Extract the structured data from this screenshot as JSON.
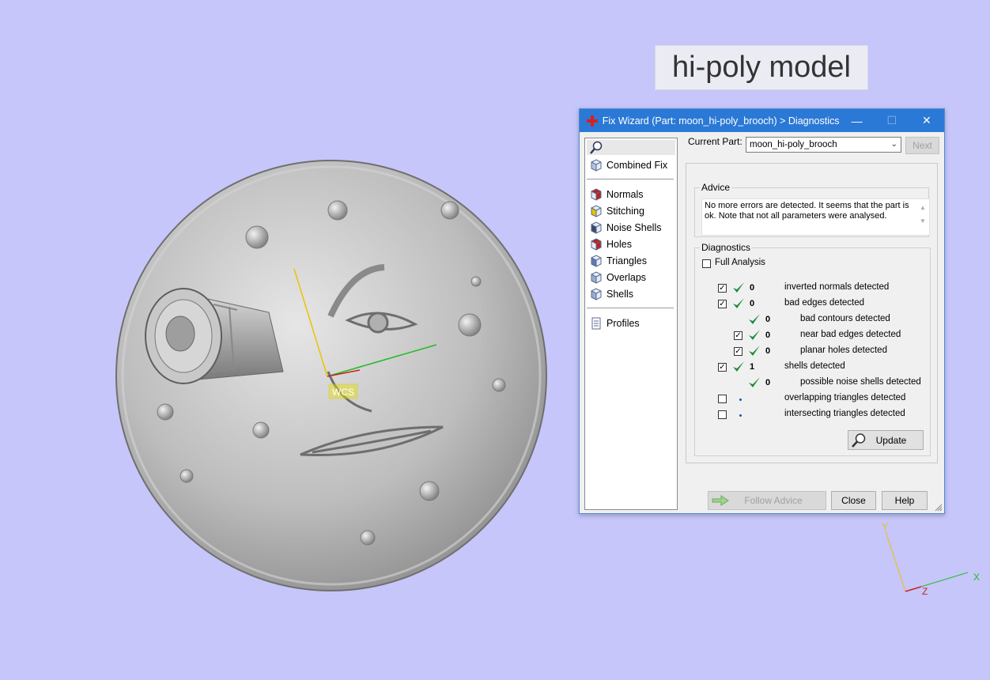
{
  "caption": "hi-poly model",
  "model": {
    "wcs_label": "WCS"
  },
  "axes_triad": {
    "x": "X",
    "y": "Y",
    "z": "Z"
  },
  "dialog": {
    "title": "Fix Wizard (Part: moon_hi-poly_brooch) > Diagnostics",
    "controls": {
      "minimize": "—",
      "maximize": "☐",
      "close": "✕"
    },
    "sidebar": {
      "top_items": [
        {
          "label": "Combined Fix",
          "icon": "combined-fix-icon"
        }
      ],
      "items": [
        {
          "label": "Normals",
          "icon": "normals-icon"
        },
        {
          "label": "Stitching",
          "icon": "stitching-icon"
        },
        {
          "label": "Noise Shells",
          "icon": "noise-shells-icon"
        },
        {
          "label": "Holes",
          "icon": "holes-icon"
        },
        {
          "label": "Triangles",
          "icon": "triangles-icon"
        },
        {
          "label": "Overlaps",
          "icon": "overlaps-icon"
        },
        {
          "label": "Shells",
          "icon": "shells-icon"
        }
      ],
      "bottom_items": [
        {
          "label": "Profiles",
          "icon": "profiles-icon"
        }
      ]
    },
    "current_part_label": "Current Part:",
    "current_part_value": "moon_hi-poly_brooch",
    "next_button": "Next",
    "advice": {
      "legend": "Advice",
      "text": "No more errors are detected. It seems that the part is ok. Note that not all parameters were analysed."
    },
    "diagnostics": {
      "legend": "Diagnostics",
      "full_analysis": {
        "label": "Full Analysis",
        "checked": false
      },
      "rows": [
        {
          "checkbox": true,
          "checked": true,
          "status": "ok",
          "count": "0",
          "label": "inverted normals detected",
          "indent": 0
        },
        {
          "checkbox": true,
          "checked": true,
          "status": "ok",
          "count": "0",
          "label": "bad edges detected",
          "indent": 0
        },
        {
          "checkbox": false,
          "checked": false,
          "status": "ok",
          "count": "0",
          "label": "bad contours detected",
          "indent": 1
        },
        {
          "checkbox": true,
          "checked": true,
          "status": "ok",
          "count": "0",
          "label": "near bad edges detected",
          "indent": 1
        },
        {
          "checkbox": true,
          "checked": true,
          "status": "ok",
          "count": "0",
          "label": "planar holes detected",
          "indent": 1
        },
        {
          "checkbox": true,
          "checked": true,
          "status": "ok",
          "count": "1",
          "label": "shells detected",
          "indent": 0
        },
        {
          "checkbox": false,
          "checked": false,
          "status": "ok",
          "count": "0",
          "label": "possible noise shells detected",
          "indent": 1
        },
        {
          "checkbox": true,
          "checked": false,
          "status": "not-run",
          "count": "",
          "label": "overlapping triangles detected",
          "indent": 0
        },
        {
          "checkbox": true,
          "checked": false,
          "status": "not-run",
          "count": "",
          "label": "intersecting triangles detected",
          "indent": 0
        }
      ],
      "update_button": "Update"
    },
    "footer": {
      "follow_advice": "Follow Advice",
      "close": "Close",
      "help": "Help"
    }
  },
  "colors": {
    "background": "#c6c6fa",
    "titlebar": "#2b79d6",
    "check_green": "#1e8a3a",
    "axis_x": "#22bb22",
    "axis_y": "#e8c400",
    "axis_z": "#cc2222"
  }
}
